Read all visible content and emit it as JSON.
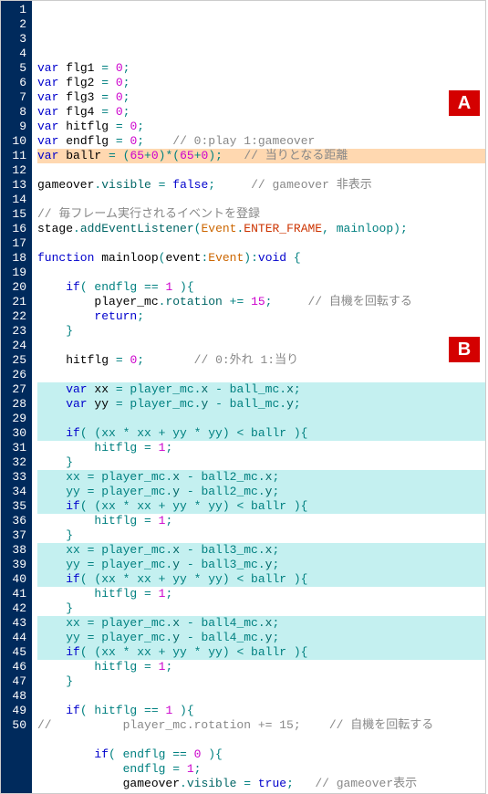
{
  "labels": {
    "a": "A",
    "b": "B"
  },
  "lines": [
    {
      "n": 1,
      "hl": "",
      "tokens": [
        {
          "t": "var ",
          "c": "kw"
        },
        {
          "t": "flg1 ",
          "c": "ident"
        },
        {
          "t": "= ",
          "c": "op"
        },
        {
          "t": "0",
          "c": "num"
        },
        {
          "t": ";",
          "c": "op"
        }
      ]
    },
    {
      "n": 2,
      "hl": "",
      "tokens": [
        {
          "t": "var ",
          "c": "kw"
        },
        {
          "t": "flg2 ",
          "c": "ident"
        },
        {
          "t": "= ",
          "c": "op"
        },
        {
          "t": "0",
          "c": "num"
        },
        {
          "t": ";",
          "c": "op"
        }
      ]
    },
    {
      "n": 3,
      "hl": "",
      "tokens": [
        {
          "t": "var ",
          "c": "kw"
        },
        {
          "t": "flg3 ",
          "c": "ident"
        },
        {
          "t": "= ",
          "c": "op"
        },
        {
          "t": "0",
          "c": "num"
        },
        {
          "t": ";",
          "c": "op"
        }
      ]
    },
    {
      "n": 4,
      "hl": "",
      "tokens": [
        {
          "t": "var ",
          "c": "kw"
        },
        {
          "t": "flg4 ",
          "c": "ident"
        },
        {
          "t": "= ",
          "c": "op"
        },
        {
          "t": "0",
          "c": "num"
        },
        {
          "t": ";",
          "c": "op"
        }
      ]
    },
    {
      "n": 5,
      "hl": "",
      "tokens": [
        {
          "t": "var ",
          "c": "kw"
        },
        {
          "t": "hitflg ",
          "c": "ident"
        },
        {
          "t": "= ",
          "c": "op"
        },
        {
          "t": "0",
          "c": "num"
        },
        {
          "t": ";",
          "c": "op"
        }
      ]
    },
    {
      "n": 6,
      "hl": "",
      "tokens": [
        {
          "t": "var ",
          "c": "kw"
        },
        {
          "t": "endflg ",
          "c": "ident"
        },
        {
          "t": "= ",
          "c": "op"
        },
        {
          "t": "0",
          "c": "num"
        },
        {
          "t": ";    ",
          "c": "op"
        },
        {
          "t": "// 0:play 1:gameover",
          "c": "comment"
        }
      ]
    },
    {
      "n": 7,
      "hl": "hl-orange",
      "tokens": [
        {
          "t": "var ",
          "c": "kw"
        },
        {
          "t": "ballr ",
          "c": "ident"
        },
        {
          "t": "= (",
          "c": "op"
        },
        {
          "t": "65",
          "c": "num"
        },
        {
          "t": "+",
          "c": "op"
        },
        {
          "t": "0",
          "c": "num"
        },
        {
          "t": ")*(",
          "c": "op"
        },
        {
          "t": "65",
          "c": "num"
        },
        {
          "t": "+",
          "c": "op"
        },
        {
          "t": "0",
          "c": "num"
        },
        {
          "t": ");   ",
          "c": "op"
        },
        {
          "t": "// 当りとなる距離",
          "c": "comment"
        }
      ]
    },
    {
      "n": 8,
      "hl": "",
      "tokens": []
    },
    {
      "n": 9,
      "hl": "",
      "tokens": [
        {
          "t": "gameover",
          "c": "ident"
        },
        {
          "t": ".",
          "c": "op"
        },
        {
          "t": "visible ",
          "c": "prop"
        },
        {
          "t": "= ",
          "c": "op"
        },
        {
          "t": "false",
          "c": "bool"
        },
        {
          "t": ";     ",
          "c": "op"
        },
        {
          "t": "// gameover 非表示",
          "c": "comment"
        }
      ]
    },
    {
      "n": 10,
      "hl": "",
      "tokens": []
    },
    {
      "n": 11,
      "hl": "",
      "tokens": [
        {
          "t": "// 毎フレーム実行されるイベントを登録",
          "c": "comment"
        }
      ]
    },
    {
      "n": 12,
      "hl": "",
      "tokens": [
        {
          "t": "stage",
          "c": "ident"
        },
        {
          "t": ".",
          "c": "op"
        },
        {
          "t": "addEventListener",
          "c": "method"
        },
        {
          "t": "(",
          "c": "op"
        },
        {
          "t": "Event",
          "c": "class"
        },
        {
          "t": ".",
          "c": "op"
        },
        {
          "t": "ENTER_FRAME",
          "c": "type"
        },
        {
          "t": ", mainloop);",
          "c": "op"
        }
      ]
    },
    {
      "n": 13,
      "hl": "",
      "tokens": []
    },
    {
      "n": 14,
      "hl": "",
      "tokens": [
        {
          "t": "function ",
          "c": "kw"
        },
        {
          "t": "mainloop",
          "c": "ident"
        },
        {
          "t": "(",
          "c": "op"
        },
        {
          "t": "event",
          "c": "ident"
        },
        {
          "t": ":",
          "c": "op"
        },
        {
          "t": "Event",
          "c": "class"
        },
        {
          "t": "):",
          "c": "op"
        },
        {
          "t": "void ",
          "c": "kw"
        },
        {
          "t": "{",
          "c": "op"
        }
      ]
    },
    {
      "n": 15,
      "hl": "",
      "tokens": []
    },
    {
      "n": 16,
      "hl": "",
      "tokens": [
        {
          "t": "    if",
          "c": "kw"
        },
        {
          "t": "( endflg == ",
          "c": "op"
        },
        {
          "t": "1 ",
          "c": "num"
        },
        {
          "t": "){",
          "c": "op"
        }
      ]
    },
    {
      "n": 17,
      "hl": "",
      "tokens": [
        {
          "t": "        player_mc",
          "c": "ident"
        },
        {
          "t": ".",
          "c": "op"
        },
        {
          "t": "rotation ",
          "c": "prop"
        },
        {
          "t": "+= ",
          "c": "op"
        },
        {
          "t": "15",
          "c": "num"
        },
        {
          "t": ";     ",
          "c": "op"
        },
        {
          "t": "// 自機を回転する",
          "c": "comment"
        }
      ]
    },
    {
      "n": 18,
      "hl": "",
      "tokens": [
        {
          "t": "        return",
          "c": "kw"
        },
        {
          "t": ";",
          "c": "op"
        }
      ]
    },
    {
      "n": 19,
      "hl": "",
      "tokens": [
        {
          "t": "    }",
          "c": "op"
        }
      ]
    },
    {
      "n": 20,
      "hl": "",
      "tokens": []
    },
    {
      "n": 21,
      "hl": "",
      "tokens": [
        {
          "t": "    hitflg ",
          "c": "ident"
        },
        {
          "t": "= ",
          "c": "op"
        },
        {
          "t": "0",
          "c": "num"
        },
        {
          "t": ";       ",
          "c": "op"
        },
        {
          "t": "// 0:外れ 1:当り",
          "c": "comment"
        }
      ]
    },
    {
      "n": 22,
      "hl": "",
      "tokens": []
    },
    {
      "n": 23,
      "hl": "hl-cyan",
      "tokens": [
        {
          "t": "    var ",
          "c": "kw"
        },
        {
          "t": "xx ",
          "c": "ident"
        },
        {
          "t": "= player_mc.",
          "c": "op"
        },
        {
          "t": "x ",
          "c": "prop"
        },
        {
          "t": "- ball_mc.",
          "c": "op"
        },
        {
          "t": "x",
          "c": "prop"
        },
        {
          "t": ";",
          "c": "op"
        }
      ]
    },
    {
      "n": 24,
      "hl": "hl-cyan",
      "tokens": [
        {
          "t": "    var ",
          "c": "kw"
        },
        {
          "t": "yy ",
          "c": "ident"
        },
        {
          "t": "= player_mc.",
          "c": "op"
        },
        {
          "t": "y ",
          "c": "prop"
        },
        {
          "t": "- ball_mc.",
          "c": "op"
        },
        {
          "t": "y",
          "c": "prop"
        },
        {
          "t": ";",
          "c": "op"
        }
      ]
    },
    {
      "n": 25,
      "hl": "hl-cyan",
      "tokens": []
    },
    {
      "n": 26,
      "hl": "hl-cyan",
      "tokens": [
        {
          "t": "    if",
          "c": "kw"
        },
        {
          "t": "( (xx * xx + yy * yy) < ballr ){",
          "c": "op"
        }
      ]
    },
    {
      "n": 27,
      "hl": "",
      "tokens": [
        {
          "t": "        hitflg = ",
          "c": "op"
        },
        {
          "t": "1",
          "c": "num"
        },
        {
          "t": ";",
          "c": "op"
        }
      ]
    },
    {
      "n": 28,
      "hl": "",
      "tokens": [
        {
          "t": "    }",
          "c": "op"
        }
      ]
    },
    {
      "n": 29,
      "hl": "hl-cyan",
      "tokens": [
        {
          "t": "    xx = player_mc.",
          "c": "op"
        },
        {
          "t": "x ",
          "c": "prop"
        },
        {
          "t": "- ball2_mc.",
          "c": "op"
        },
        {
          "t": "x",
          "c": "prop"
        },
        {
          "t": ";",
          "c": "op"
        }
      ]
    },
    {
      "n": 30,
      "hl": "hl-cyan",
      "tokens": [
        {
          "t": "    yy = player_mc.",
          "c": "op"
        },
        {
          "t": "y ",
          "c": "prop"
        },
        {
          "t": "- ball2_mc.",
          "c": "op"
        },
        {
          "t": "y",
          "c": "prop"
        },
        {
          "t": ";",
          "c": "op"
        }
      ]
    },
    {
      "n": 31,
      "hl": "hl-cyan",
      "tokens": [
        {
          "t": "    if",
          "c": "kw"
        },
        {
          "t": "( (xx * xx + yy * yy) < ballr ){",
          "c": "op"
        }
      ]
    },
    {
      "n": 32,
      "hl": "",
      "tokens": [
        {
          "t": "        hitflg = ",
          "c": "op"
        },
        {
          "t": "1",
          "c": "num"
        },
        {
          "t": ";",
          "c": "op"
        }
      ]
    },
    {
      "n": 33,
      "hl": "",
      "tokens": [
        {
          "t": "    }",
          "c": "op"
        }
      ]
    },
    {
      "n": 34,
      "hl": "hl-cyan",
      "tokens": [
        {
          "t": "    xx = player_mc.",
          "c": "op"
        },
        {
          "t": "x ",
          "c": "prop"
        },
        {
          "t": "- ball3_mc.",
          "c": "op"
        },
        {
          "t": "x",
          "c": "prop"
        },
        {
          "t": ";",
          "c": "op"
        }
      ]
    },
    {
      "n": 35,
      "hl": "hl-cyan",
      "tokens": [
        {
          "t": "    yy = player_mc.",
          "c": "op"
        },
        {
          "t": "y ",
          "c": "prop"
        },
        {
          "t": "- ball3_mc.",
          "c": "op"
        },
        {
          "t": "y",
          "c": "prop"
        },
        {
          "t": ";",
          "c": "op"
        }
      ]
    },
    {
      "n": 36,
      "hl": "hl-cyan",
      "tokens": [
        {
          "t": "    if",
          "c": "kw"
        },
        {
          "t": "( (xx * xx + yy * yy) < ballr ){",
          "c": "op"
        }
      ]
    },
    {
      "n": 37,
      "hl": "",
      "tokens": [
        {
          "t": "        hitflg = ",
          "c": "op"
        },
        {
          "t": "1",
          "c": "num"
        },
        {
          "t": ";",
          "c": "op"
        }
      ]
    },
    {
      "n": 38,
      "hl": "",
      "tokens": [
        {
          "t": "    }",
          "c": "op"
        }
      ]
    },
    {
      "n": 39,
      "hl": "hl-cyan",
      "tokens": [
        {
          "t": "    xx = player_mc.",
          "c": "op"
        },
        {
          "t": "x ",
          "c": "prop"
        },
        {
          "t": "- ball4_mc.",
          "c": "op"
        },
        {
          "t": "x",
          "c": "prop"
        },
        {
          "t": ";",
          "c": "op"
        }
      ]
    },
    {
      "n": 40,
      "hl": "hl-cyan",
      "tokens": [
        {
          "t": "    yy = player_mc.",
          "c": "op"
        },
        {
          "t": "y ",
          "c": "prop"
        },
        {
          "t": "- ball4_mc.",
          "c": "op"
        },
        {
          "t": "y",
          "c": "prop"
        },
        {
          "t": ";",
          "c": "op"
        }
      ]
    },
    {
      "n": 41,
      "hl": "hl-cyan",
      "tokens": [
        {
          "t": "    if",
          "c": "kw"
        },
        {
          "t": "( (xx * xx + yy * yy) < ballr ){",
          "c": "op"
        }
      ]
    },
    {
      "n": 42,
      "hl": "",
      "tokens": [
        {
          "t": "        hitflg = ",
          "c": "op"
        },
        {
          "t": "1",
          "c": "num"
        },
        {
          "t": ";",
          "c": "op"
        }
      ]
    },
    {
      "n": 43,
      "hl": "",
      "tokens": [
        {
          "t": "    }",
          "c": "op"
        }
      ]
    },
    {
      "n": 44,
      "hl": "",
      "tokens": []
    },
    {
      "n": 45,
      "hl": "",
      "tokens": [
        {
          "t": "    if",
          "c": "kw"
        },
        {
          "t": "( hitflg == ",
          "c": "op"
        },
        {
          "t": "1 ",
          "c": "num"
        },
        {
          "t": "){",
          "c": "op"
        }
      ]
    },
    {
      "n": 46,
      "hl": "",
      "tokens": [
        {
          "t": "//          player_mc.rotation += 15;    // 自機を回転する",
          "c": "comment"
        }
      ]
    },
    {
      "n": 47,
      "hl": "",
      "tokens": []
    },
    {
      "n": 48,
      "hl": "",
      "tokens": [
        {
          "t": "        if",
          "c": "kw"
        },
        {
          "t": "( endflg == ",
          "c": "op"
        },
        {
          "t": "0 ",
          "c": "num"
        },
        {
          "t": "){",
          "c": "op"
        }
      ]
    },
    {
      "n": 49,
      "hl": "",
      "tokens": [
        {
          "t": "            endflg = ",
          "c": "op"
        },
        {
          "t": "1",
          "c": "num"
        },
        {
          "t": ";",
          "c": "op"
        }
      ]
    },
    {
      "n": 50,
      "hl": "",
      "tokens": [
        {
          "t": "            gameover",
          "c": "ident"
        },
        {
          "t": ".",
          "c": "op"
        },
        {
          "t": "visible ",
          "c": "prop"
        },
        {
          "t": "= ",
          "c": "op"
        },
        {
          "t": "true",
          "c": "bool"
        },
        {
          "t": ";   ",
          "c": "op"
        },
        {
          "t": "// gameover表示",
          "c": "comment"
        }
      ]
    }
  ]
}
